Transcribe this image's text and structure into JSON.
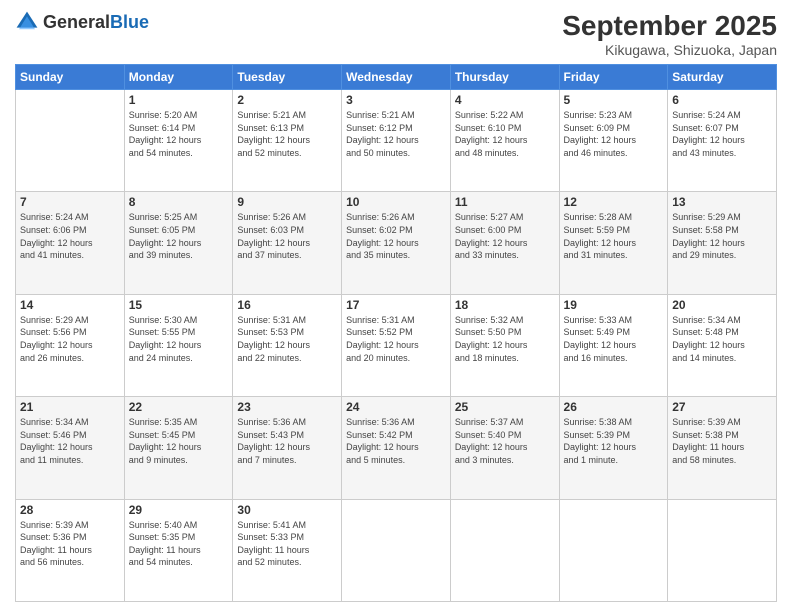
{
  "header": {
    "logo_general": "General",
    "logo_blue": "Blue",
    "month": "September 2025",
    "location": "Kikugawa, Shizuoka, Japan"
  },
  "days_of_week": [
    "Sunday",
    "Monday",
    "Tuesday",
    "Wednesday",
    "Thursday",
    "Friday",
    "Saturday"
  ],
  "weeks": [
    [
      {
        "day": "",
        "info": ""
      },
      {
        "day": "1",
        "info": "Sunrise: 5:20 AM\nSunset: 6:14 PM\nDaylight: 12 hours\nand 54 minutes."
      },
      {
        "day": "2",
        "info": "Sunrise: 5:21 AM\nSunset: 6:13 PM\nDaylight: 12 hours\nand 52 minutes."
      },
      {
        "day": "3",
        "info": "Sunrise: 5:21 AM\nSunset: 6:12 PM\nDaylight: 12 hours\nand 50 minutes."
      },
      {
        "day": "4",
        "info": "Sunrise: 5:22 AM\nSunset: 6:10 PM\nDaylight: 12 hours\nand 48 minutes."
      },
      {
        "day": "5",
        "info": "Sunrise: 5:23 AM\nSunset: 6:09 PM\nDaylight: 12 hours\nand 46 minutes."
      },
      {
        "day": "6",
        "info": "Sunrise: 5:24 AM\nSunset: 6:07 PM\nDaylight: 12 hours\nand 43 minutes."
      }
    ],
    [
      {
        "day": "7",
        "info": "Sunrise: 5:24 AM\nSunset: 6:06 PM\nDaylight: 12 hours\nand 41 minutes."
      },
      {
        "day": "8",
        "info": "Sunrise: 5:25 AM\nSunset: 6:05 PM\nDaylight: 12 hours\nand 39 minutes."
      },
      {
        "day": "9",
        "info": "Sunrise: 5:26 AM\nSunset: 6:03 PM\nDaylight: 12 hours\nand 37 minutes."
      },
      {
        "day": "10",
        "info": "Sunrise: 5:26 AM\nSunset: 6:02 PM\nDaylight: 12 hours\nand 35 minutes."
      },
      {
        "day": "11",
        "info": "Sunrise: 5:27 AM\nSunset: 6:00 PM\nDaylight: 12 hours\nand 33 minutes."
      },
      {
        "day": "12",
        "info": "Sunrise: 5:28 AM\nSunset: 5:59 PM\nDaylight: 12 hours\nand 31 minutes."
      },
      {
        "day": "13",
        "info": "Sunrise: 5:29 AM\nSunset: 5:58 PM\nDaylight: 12 hours\nand 29 minutes."
      }
    ],
    [
      {
        "day": "14",
        "info": "Sunrise: 5:29 AM\nSunset: 5:56 PM\nDaylight: 12 hours\nand 26 minutes."
      },
      {
        "day": "15",
        "info": "Sunrise: 5:30 AM\nSunset: 5:55 PM\nDaylight: 12 hours\nand 24 minutes."
      },
      {
        "day": "16",
        "info": "Sunrise: 5:31 AM\nSunset: 5:53 PM\nDaylight: 12 hours\nand 22 minutes."
      },
      {
        "day": "17",
        "info": "Sunrise: 5:31 AM\nSunset: 5:52 PM\nDaylight: 12 hours\nand 20 minutes."
      },
      {
        "day": "18",
        "info": "Sunrise: 5:32 AM\nSunset: 5:50 PM\nDaylight: 12 hours\nand 18 minutes."
      },
      {
        "day": "19",
        "info": "Sunrise: 5:33 AM\nSunset: 5:49 PM\nDaylight: 12 hours\nand 16 minutes."
      },
      {
        "day": "20",
        "info": "Sunrise: 5:34 AM\nSunset: 5:48 PM\nDaylight: 12 hours\nand 14 minutes."
      }
    ],
    [
      {
        "day": "21",
        "info": "Sunrise: 5:34 AM\nSunset: 5:46 PM\nDaylight: 12 hours\nand 11 minutes."
      },
      {
        "day": "22",
        "info": "Sunrise: 5:35 AM\nSunset: 5:45 PM\nDaylight: 12 hours\nand 9 minutes."
      },
      {
        "day": "23",
        "info": "Sunrise: 5:36 AM\nSunset: 5:43 PM\nDaylight: 12 hours\nand 7 minutes."
      },
      {
        "day": "24",
        "info": "Sunrise: 5:36 AM\nSunset: 5:42 PM\nDaylight: 12 hours\nand 5 minutes."
      },
      {
        "day": "25",
        "info": "Sunrise: 5:37 AM\nSunset: 5:40 PM\nDaylight: 12 hours\nand 3 minutes."
      },
      {
        "day": "26",
        "info": "Sunrise: 5:38 AM\nSunset: 5:39 PM\nDaylight: 12 hours\nand 1 minute."
      },
      {
        "day": "27",
        "info": "Sunrise: 5:39 AM\nSunset: 5:38 PM\nDaylight: 11 hours\nand 58 minutes."
      }
    ],
    [
      {
        "day": "28",
        "info": "Sunrise: 5:39 AM\nSunset: 5:36 PM\nDaylight: 11 hours\nand 56 minutes."
      },
      {
        "day": "29",
        "info": "Sunrise: 5:40 AM\nSunset: 5:35 PM\nDaylight: 11 hours\nand 54 minutes."
      },
      {
        "day": "30",
        "info": "Sunrise: 5:41 AM\nSunset: 5:33 PM\nDaylight: 11 hours\nand 52 minutes."
      },
      {
        "day": "",
        "info": ""
      },
      {
        "day": "",
        "info": ""
      },
      {
        "day": "",
        "info": ""
      },
      {
        "day": "",
        "info": ""
      }
    ]
  ]
}
